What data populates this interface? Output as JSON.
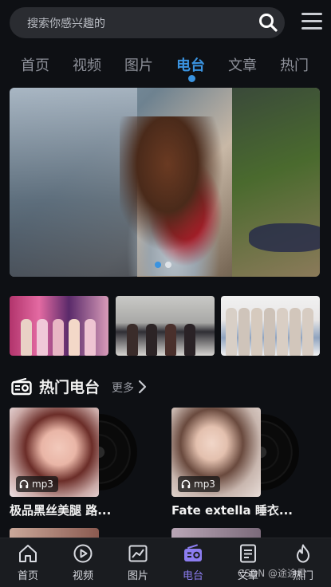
{
  "search": {
    "placeholder": "搜索你感兴趣的"
  },
  "tabs": [
    {
      "label": "首页"
    },
    {
      "label": "视频"
    },
    {
      "label": "图片"
    },
    {
      "label": "电台",
      "active": true
    },
    {
      "label": "文章"
    },
    {
      "label": "热门"
    }
  ],
  "banner": {
    "slide_count": 2,
    "active_slide": 1
  },
  "thumbnails": [
    {
      "id": "thumb-1"
    },
    {
      "id": "thumb-2"
    },
    {
      "id": "thumb-3"
    }
  ],
  "section": {
    "title": "热门电台",
    "more": "更多"
  },
  "cards": [
    {
      "badge": "mp3",
      "title": "极品黑丝美腿 路..."
    },
    {
      "badge": "mp3",
      "title": "Fate extella 睡衣..."
    }
  ],
  "bottom_nav": [
    {
      "label": "首页",
      "icon": "home-icon"
    },
    {
      "label": "视频",
      "icon": "play-icon"
    },
    {
      "label": "图片",
      "icon": "chart-icon"
    },
    {
      "label": "电台",
      "icon": "radio-icon",
      "active": true
    },
    {
      "label": "文章",
      "icon": "document-icon"
    },
    {
      "label": "热门",
      "icon": "flame-icon"
    }
  ],
  "watermark": "CSDN @途途君",
  "colors": {
    "background": "#0e1014",
    "accent": "#3a93e0",
    "nav_active": "#8c7df0",
    "search_bg": "#2a2c31"
  }
}
